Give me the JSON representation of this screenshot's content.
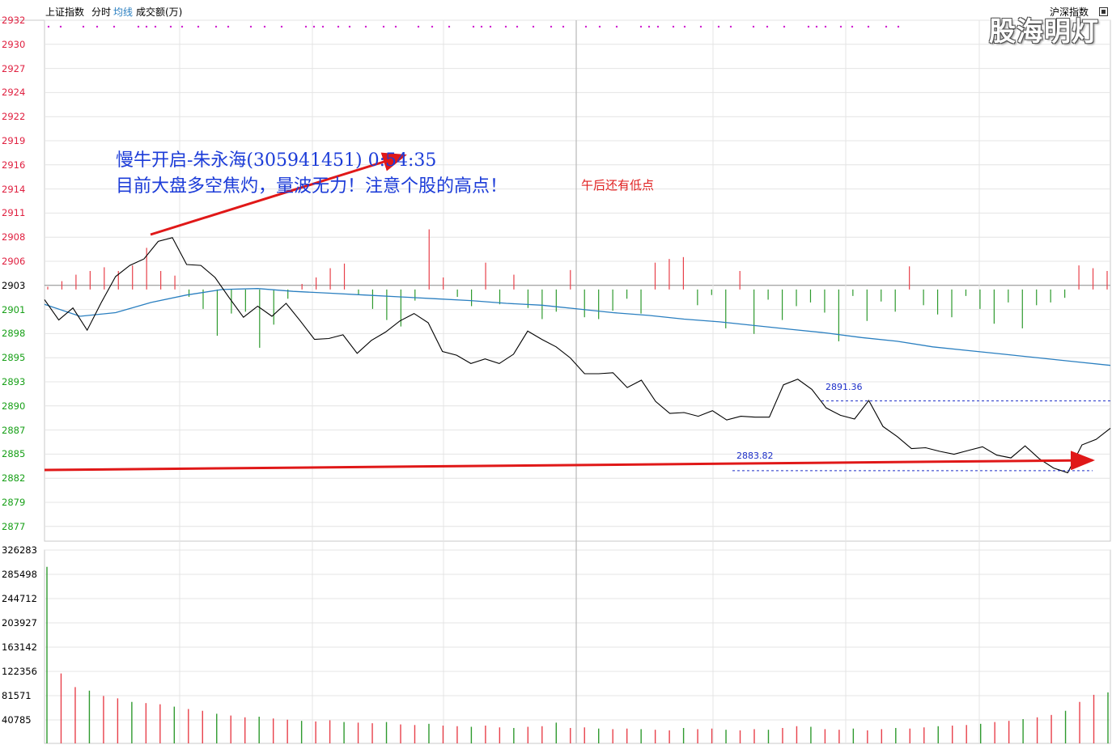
{
  "header": {
    "index_name": "上证指数",
    "tabs": [
      "分时",
      "均线",
      "成交额(万)"
    ],
    "right_label": "沪深指数",
    "watermark": "股海明灯"
  },
  "price_axis": {
    "labels": [
      "2932",
      "2930",
      "2927",
      "2924",
      "2922",
      "2919",
      "2916",
      "2914",
      "2911",
      "2908",
      "2906",
      "2903",
      "2901",
      "2898",
      "2895",
      "2893",
      "2890",
      "2887",
      "2885",
      "2882",
      "2879",
      "2877"
    ],
    "reference": "2903"
  },
  "volume_axis": {
    "labels": [
      "326283",
      "285498",
      "244712",
      "203927",
      "163142",
      "122356",
      "81571",
      "40785"
    ]
  },
  "annotations": {
    "line1": "慢牛开启-朱永海(305941451)  0:54:35",
    "line2": "目前大盘多空焦灼，量波无力！注意个股的高点！",
    "note": "午后还有低点",
    "level_high": "2891.36",
    "level_low": "2883.82"
  },
  "colors": {
    "up": "#e8404a",
    "down": "#2e9a2e",
    "avg_line": "#2a7fc0",
    "price_line": "#000000",
    "axis_red": "#e02040",
    "axis_green": "#18a018",
    "arrow": "#e01818"
  },
  "chart_data": {
    "type": "line",
    "reference_price": 2903.4,
    "price": [
      2902.3,
      2900.1,
      2901.4,
      2899.0,
      2902.0,
      2904.8,
      2906.0,
      2906.7,
      2908.6,
      2909.0,
      2906.1,
      2906.0,
      2904.7,
      2902.5,
      2900.4,
      2901.6,
      2900.5,
      2901.9,
      2900.0,
      2898.0,
      2898.1,
      2898.5,
      2896.5,
      2897.9,
      2898.8,
      2900.0,
      2900.8,
      2899.8,
      2896.7,
      2896.3,
      2895.4,
      2895.9,
      2895.4,
      2896.4,
      2898.9,
      2898.0,
      2897.2,
      2896.0,
      2894.3,
      2894.3,
      2894.4,
      2892.8,
      2893.6,
      2891.3,
      2890.0,
      2890.1,
      2889.7,
      2890.3,
      2889.3,
      2889.7,
      2889.6,
      2889.6,
      2893.1,
      2893.7,
      2892.6,
      2890.6,
      2889.8,
      2889.4,
      2891.4,
      2888.6,
      2887.5,
      2886.2,
      2886.3,
      2885.9,
      2885.6,
      2886.0,
      2886.4,
      2885.5,
      2885.2,
      2886.5,
      2885.1,
      2884.1,
      2883.6,
      2886.6,
      2887.2,
      2888.4
    ],
    "avg_price": [
      2901.8,
      2900.5,
      2900.9,
      2902.0,
      2902.8,
      2903.4,
      2903.5,
      2903.2,
      2903.0,
      2902.8,
      2902.6,
      2902.4,
      2902.2,
      2901.9,
      2901.7,
      2901.3,
      2900.9,
      2900.6,
      2900.2,
      2899.9,
      2899.5,
      2899.1,
      2898.7,
      2898.2,
      2897.8,
      2897.2,
      2896.8,
      2896.4,
      2896.0,
      2895.6,
      2895.2
    ],
    "change_bars": [
      0.3,
      0.9,
      1.6,
      2.0,
      2.4,
      2.0,
      2.6,
      4.5,
      2.0,
      1.5,
      -0.8,
      -2.1,
      -5.0,
      -2.6,
      -2.4,
      -6.3,
      -3.8,
      -1.0,
      0.6,
      1.3,
      2.3,
      2.8,
      -0.6,
      -2.1,
      -3.3,
      -4.0,
      -1.2,
      6.5,
      1.3,
      -0.8,
      -1.8,
      2.9,
      -1.6,
      1.6,
      -2.0,
      -3.2,
      -2.4,
      2.1,
      -3.0,
      -3.2,
      -2.3,
      -1.0,
      -2.6,
      2.9,
      3.3,
      3.5,
      -1.7,
      -0.6,
      -4.2,
      2.0,
      -4.8,
      -1.1,
      -3.3,
      -1.8,
      -1.4,
      -2.5,
      -5.6,
      -0.7,
      -3.4,
      -1.3,
      -2.4,
      2.5,
      -1.7,
      -2.7,
      -3.0,
      -0.7,
      -2.1,
      -3.7,
      -1.4,
      -4.2,
      -1.7,
      -1.4,
      -0.9,
      2.6,
      2.3,
      2.0
    ],
    "volume": [
      298000,
      118000,
      95000,
      89000,
      80000,
      76000,
      70000,
      68000,
      66000,
      62000,
      58000,
      55000,
      50000,
      47000,
      44000,
      45000,
      42000,
      40000,
      38000,
      37000,
      39000,
      36000,
      35000,
      34000,
      36000,
      32000,
      31000,
      33000,
      30000,
      29000,
      28000,
      30000,
      27000,
      26000,
      28000,
      29000,
      35000,
      26000,
      27000,
      25000,
      24000,
      25000,
      24000,
      23000,
      22000,
      26000,
      24000,
      25000,
      23000,
      22000,
      24000,
      23000,
      26000,
      29000,
      28000,
      24000,
      23000,
      25000,
      22000,
      24000,
      26000,
      25000,
      27000,
      29000,
      30000,
      31000,
      33000,
      36000,
      38000,
      41000,
      44000,
      48000,
      55000,
      70000,
      82000,
      86000
    ],
    "ylim": [
      2876.2,
      2932.5
    ],
    "volume_max": 326283
  }
}
